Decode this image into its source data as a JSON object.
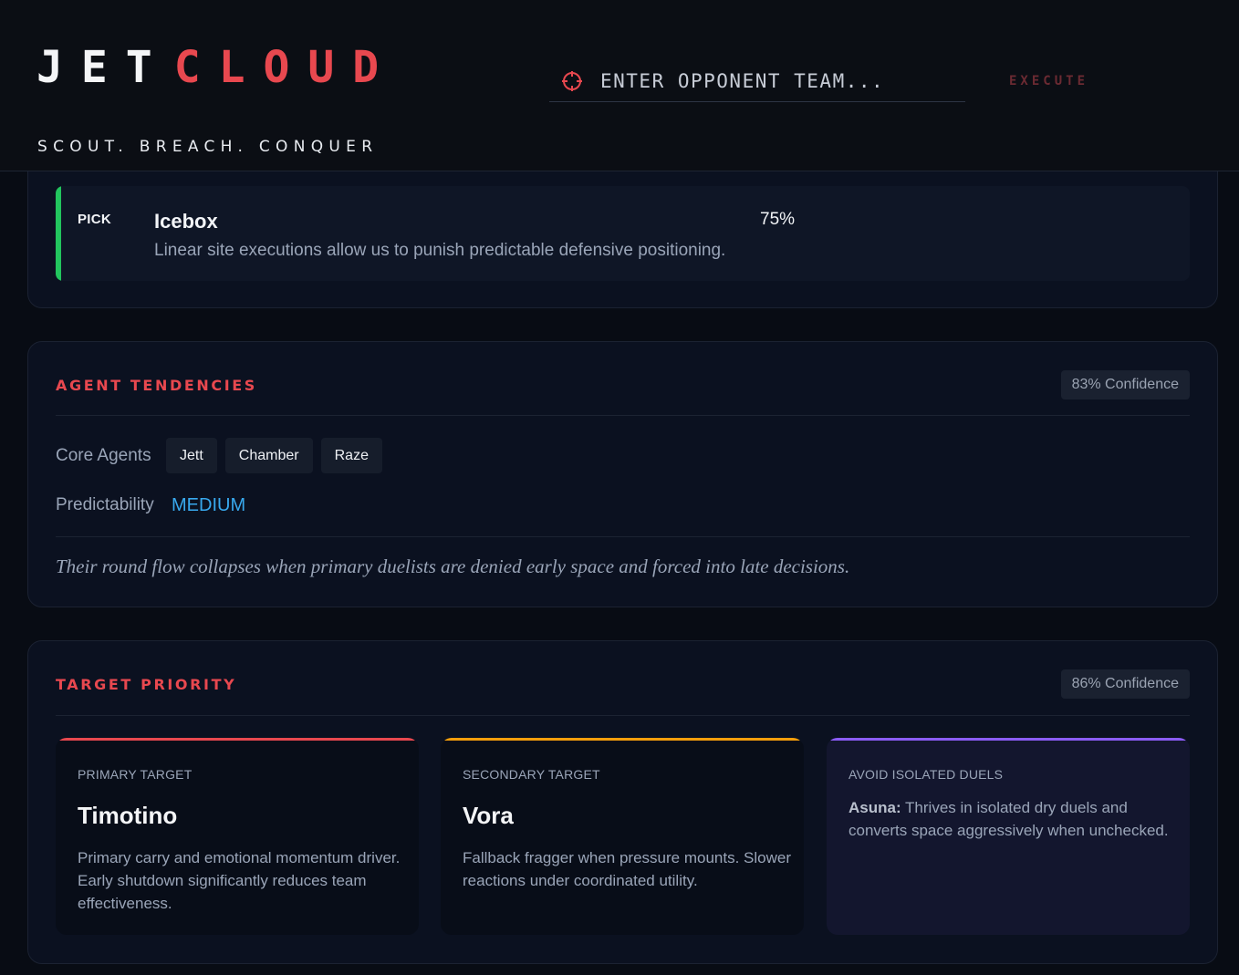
{
  "brand": {
    "part1": "JET",
    "part2": "CLOUD",
    "tagline": "SCOUT. BREACH. CONQUER"
  },
  "search": {
    "placeholder": "ENTER OPPONENT TEAM...",
    "value": "",
    "icon": "crosshair-icon"
  },
  "execute_label": "EXECUTE",
  "map_pick": {
    "tag": "PICK",
    "map": "Icebox",
    "percent": "75%",
    "reason": "Linear site executions allow us to punish predictable defensive positioning.",
    "accent_color": "#22c55e"
  },
  "agent_tendencies": {
    "title": "AGENT TENDENCIES",
    "confidence": "83% Confidence",
    "core_label": "Core Agents",
    "core_agents": [
      "Jett",
      "Chamber",
      "Raze"
    ],
    "predictability_label": "Predictability",
    "predictability": "MEDIUM",
    "note": "Their round flow collapses when primary duelists are denied early space and forced into late decisions."
  },
  "target_priority": {
    "title": "TARGET PRIORITY",
    "confidence": "86% Confidence",
    "primary": {
      "type": "PRIMARY TARGET",
      "name": "Timotino",
      "desc": "Primary carry and emotional momentum driver. Early shutdown significantly reduces team effectiveness.",
      "color": "#e8484f"
    },
    "secondary": {
      "type": "SECONDARY TARGET",
      "name": "Vora",
      "desc": "Fallback fragger when pressure mounts. Slower reactions under coordinated utility.",
      "color": "#f59e0b"
    },
    "avoid": {
      "type": "AVOID ISOLATED DUELS",
      "player": "Asuna:",
      "desc": "Thrives in isolated dry duels and converts space aggressively when unchecked.",
      "color": "#8b5cf6"
    }
  }
}
